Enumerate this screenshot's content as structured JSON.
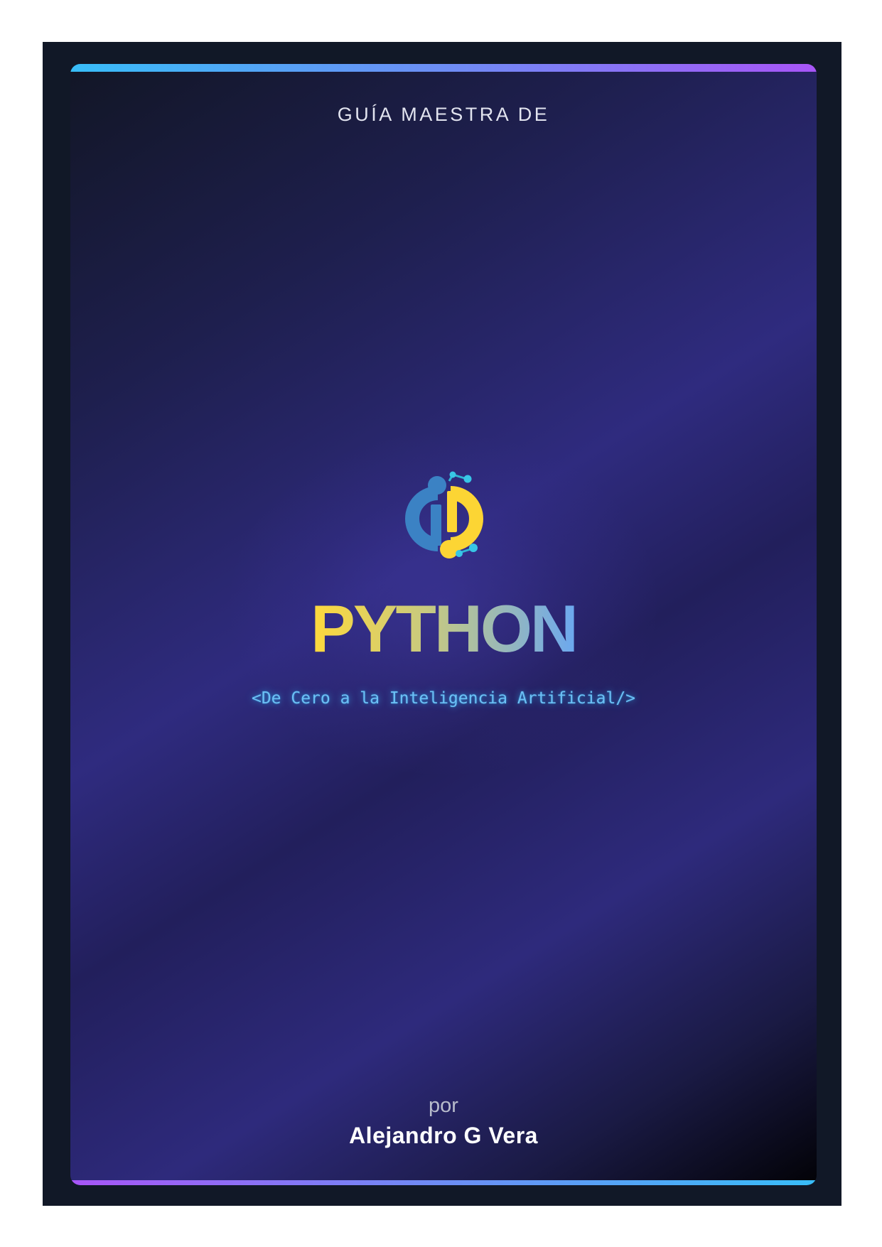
{
  "cover": {
    "eyebrow": "GUÍA MAESTRA DE",
    "title": "PYTHON",
    "subtitle": "<De Cero a la Inteligencia Artificial/>",
    "by_label": "por",
    "author": "Alejandro G Vera",
    "logo_icon": "python-ai-logo-icon"
  },
  "colors": {
    "outer_frame": "#111827",
    "title_gradient_start": "#ffd93b",
    "title_gradient_end": "#6ba8f0",
    "subtitle": "#6cc0f5",
    "accent_bar_start": "#38bdf8",
    "accent_bar_end": "#a855f7"
  }
}
